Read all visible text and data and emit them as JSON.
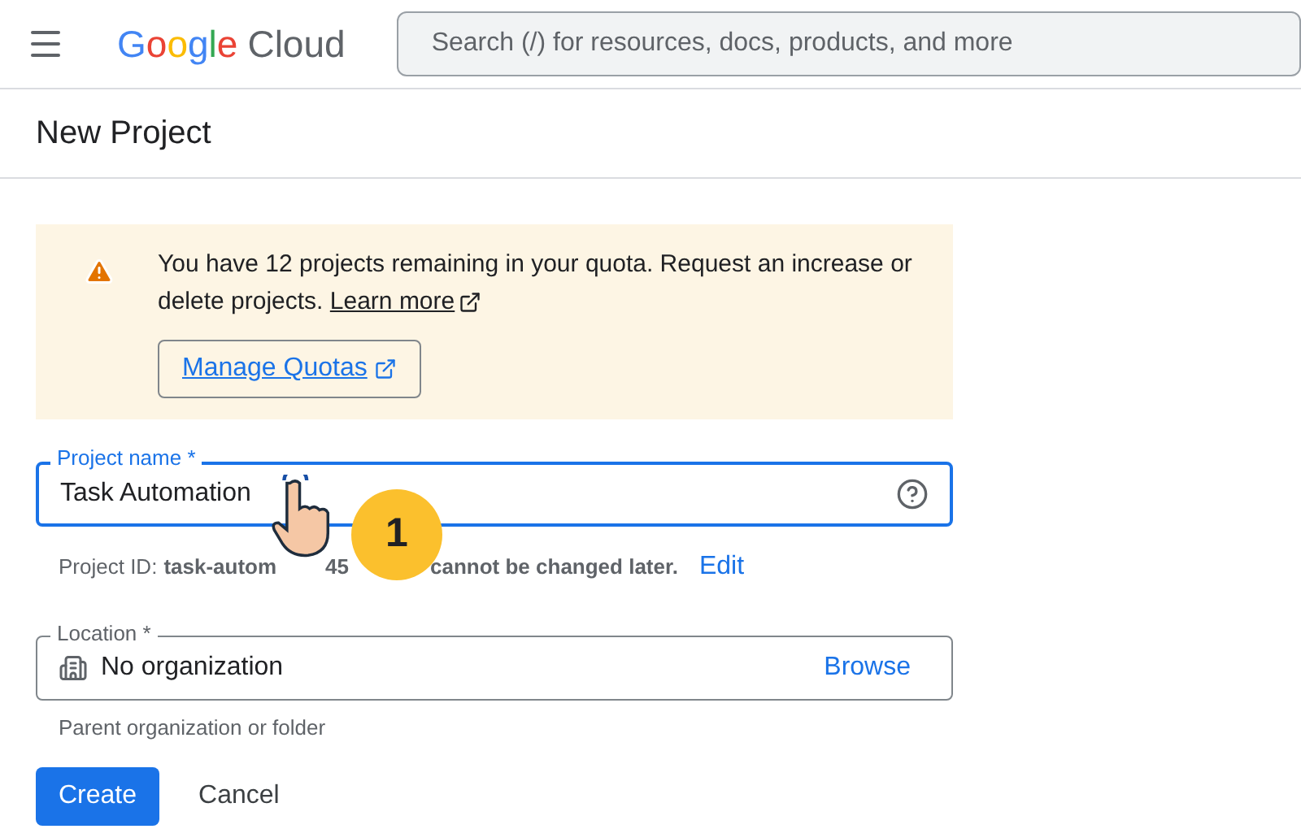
{
  "header": {
    "logo_word": "Google",
    "logo_product": "Cloud",
    "search": {
      "placeholder": "Search (/) for resources, docs, products, and more"
    }
  },
  "page_title": "New Project",
  "quota_banner": {
    "message": "You have 12 projects remaining in your quota. Request an increase or delete projects.",
    "link": "Learn more",
    "button": "Manage Quotas"
  },
  "project_name": {
    "label": "Project name *",
    "value": "Task Automation",
    "focused": true
  },
  "project_id_hint": {
    "prefix": "Project ID:",
    "id_start": "task-autom",
    "id_middle": "45",
    "suffix": "cannot be changed later.",
    "action": "Edit"
  },
  "tutorial_badge": "1",
  "location": {
    "label": "Location *",
    "value": "No organization",
    "action": "Browse",
    "hint": "Parent organization or folder"
  },
  "buttons": [
    {
      "label": "Create",
      "kind": "primary"
    },
    {
      "label": "Cancel",
      "kind": "text"
    }
  ]
}
